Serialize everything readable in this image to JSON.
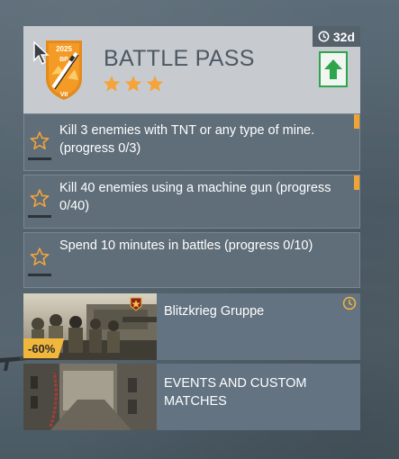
{
  "battle_pass": {
    "title": "BATTLE PASS",
    "timer": "32d",
    "emblem_year": "2025",
    "emblem_bp": "BP",
    "emblem_season": "VII",
    "stars_count": 3,
    "icons": {
      "timer": "clock-icon",
      "upgrade": "arrow-up-icon",
      "emblem": "battle-pass-emblem"
    }
  },
  "missions": [
    {
      "text": "Kill 3 enemies with TNT or any type of mine. (progress 0/3)",
      "flagged": true
    },
    {
      "text": "Kill 40 enemies using a machine gun (progress 0/40)",
      "flagged": true
    },
    {
      "text": "Spend 10 minutes in battles (progress 0/10)",
      "flagged": false
    }
  ],
  "modes": [
    {
      "title": "Blitzkrieg Gruppe",
      "discount": "-60%",
      "icons": [
        "timer-icon",
        "squad-rank-icon"
      ]
    },
    {
      "title": "EVENTS AND CUSTOM MATCHES"
    }
  ],
  "colors": {
    "accent": "#f0a436",
    "upgrade_green": "#2ea44b",
    "card": "#5f6e79",
    "header_bg": "#c7cbd0"
  }
}
